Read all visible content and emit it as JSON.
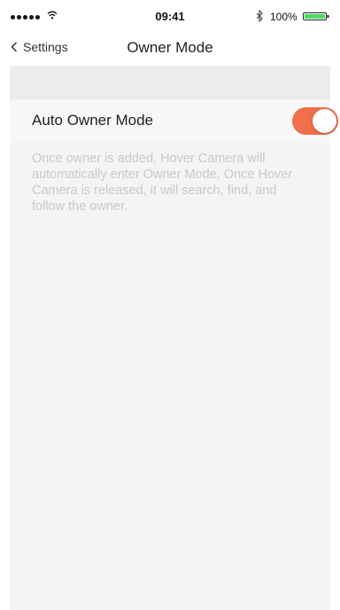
{
  "status_bar": {
    "time": "09:41",
    "battery_percent": "100%",
    "signal_bars": 5,
    "icons": [
      "wifi-icon",
      "bluetooth-icon",
      "battery-icon"
    ],
    "battery_color": "#4cd964"
  },
  "nav": {
    "back_label": "Settings",
    "title": "Owner Mode"
  },
  "setting": {
    "label": "Auto Owner Mode",
    "enabled": true,
    "toggle_color": "#f26f4b"
  },
  "description": "Once owner is added, Hover Camera will automatically enter Owner Mode. Once Hover Camera is released, it will search, find, and follow the owner."
}
